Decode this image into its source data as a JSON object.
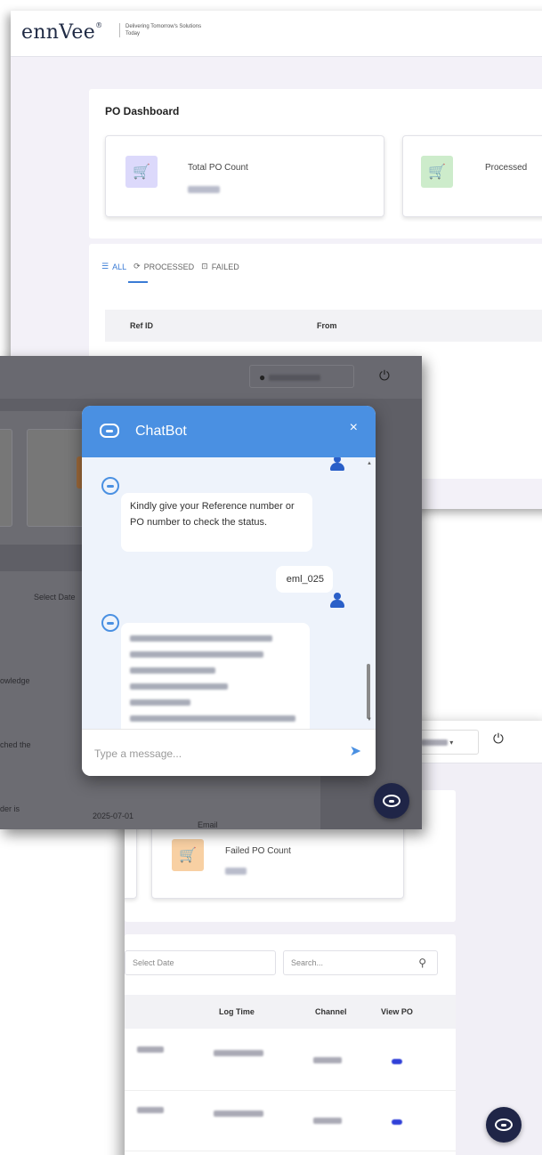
{
  "win1": {
    "logo": "ennVee",
    "logo_mark": "®",
    "tagline": "Delivering Tomorrow's Solutions Today",
    "dashboard_title": "PO Dashboard",
    "card_total_label": "Total PO Count",
    "card_processed_label": "Processed",
    "tabs": {
      "all": "ALL",
      "processed": "PROCESSED",
      "failed": "FAILED"
    },
    "table_headers": {
      "ref_id": "Ref ID",
      "from": "From"
    }
  },
  "win2": {
    "select_date": "Select Date",
    "log_date": "2025-07-01",
    "channel": "Email",
    "row_fragments": [
      "owledge",
      "ched the",
      "der is"
    ]
  },
  "chat": {
    "title": "ChatBot",
    "close": "×",
    "bot_message": "Kindly give your Reference number or PO number to check the status.",
    "user_message": "eml_025",
    "input_placeholder": "Type a message...",
    "send": "➤"
  },
  "win3": {
    "failed_label": "Failed PO Count",
    "select_date_placeholder": "Select Date",
    "search_placeholder": "Search...",
    "table_headers": {
      "log_time": "Log Time",
      "channel": "Channel",
      "view_po": "View PO"
    }
  },
  "colors": {
    "accent": "#4a90e2",
    "total_icon_bg": "#dcd9fb",
    "processed_icon_bg": "#cdeccb",
    "failed_icon_bg": "#f8d0a3",
    "bot_button": "#1f2547"
  }
}
